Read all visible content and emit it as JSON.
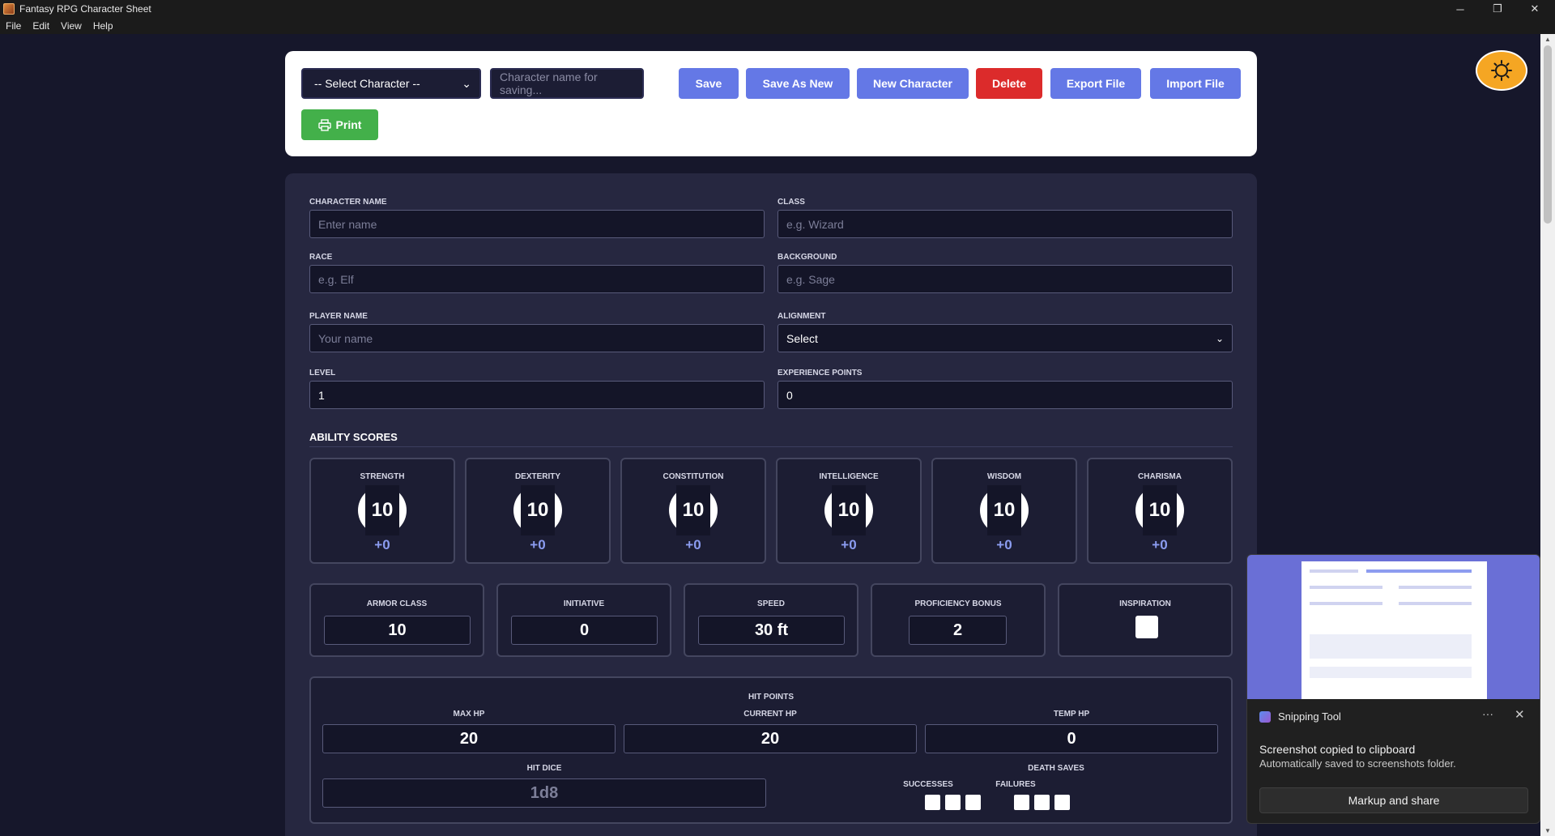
{
  "window": {
    "title": "Fantasy RPG Character Sheet",
    "controls": {
      "minimize": "─",
      "restore": "❐",
      "close": "✕"
    }
  },
  "menu": [
    "File",
    "Edit",
    "View",
    "Help"
  ],
  "toolbar": {
    "select_character": "-- Select Character --",
    "name_placeholder": "Character name for saving...",
    "save": "Save",
    "save_as_new": "Save As New",
    "new_character": "New Character",
    "delete": "Delete",
    "export_file": "Export File",
    "import_file": "Import File",
    "print": "Print"
  },
  "colors": {
    "accent": "#6478e6",
    "danger": "#dc2b2b",
    "success": "#43b04a",
    "theme_toggle": "#f5a623",
    "background": "#16172b",
    "card": "#262740"
  },
  "character": {
    "name": {
      "label": "Character Name",
      "placeholder": "Enter name"
    },
    "class": {
      "label": "Class",
      "placeholder": "e.g. Wizard"
    },
    "race": {
      "label": "Race",
      "placeholder": "e.g. Elf"
    },
    "background": {
      "label": "Background",
      "placeholder": "e.g. Sage"
    },
    "player_name": {
      "label": "Player Name",
      "placeholder": "Your name"
    },
    "alignment": {
      "label": "Alignment",
      "value": "Select"
    },
    "level": {
      "label": "Level",
      "value": "1"
    },
    "experience": {
      "label": "Experience Points",
      "value": "0"
    }
  },
  "abilities_title": "ABILITY SCORES",
  "abilities": [
    {
      "name": "STRENGTH",
      "score": "10",
      "modifier": "+0"
    },
    {
      "name": "DEXTERITY",
      "score": "10",
      "modifier": "+0"
    },
    {
      "name": "CONSTITUTION",
      "score": "10",
      "modifier": "+0"
    },
    {
      "name": "INTELLIGENCE",
      "score": "10",
      "modifier": "+0"
    },
    {
      "name": "WISDOM",
      "score": "10",
      "modifier": "+0"
    },
    {
      "name": "CHARISMA",
      "score": "10",
      "modifier": "+0"
    }
  ],
  "stats": {
    "armor_class": {
      "label": "ARMOR CLASS",
      "value": "10"
    },
    "initiative": {
      "label": "INITIATIVE",
      "value": "0"
    },
    "speed": {
      "label": "SPEED",
      "value": "30 ft"
    },
    "proficiency": {
      "label": "PROFICIENCY BONUS",
      "value": "2"
    },
    "inspiration": {
      "label": "INSPIRATION",
      "checked": false
    }
  },
  "hit_points": {
    "title": "HIT POINTS",
    "max_label": "MAX HP",
    "max": "20",
    "current_label": "CURRENT HP",
    "current": "20",
    "temp_label": "TEMP HP",
    "temp": "0",
    "hit_dice_label": "HIT DICE",
    "hit_dice_placeholder": "1d8",
    "death_saves_label": "DEATH SAVES",
    "successes_label": "SUCCESSES",
    "failures_label": "FAILURES"
  },
  "toast": {
    "app": "Snipping Tool",
    "more": "···",
    "close": "✕",
    "message": "Screenshot copied to clipboard",
    "detail": "Automatically saved to screenshots folder.",
    "action": "Markup and share"
  }
}
